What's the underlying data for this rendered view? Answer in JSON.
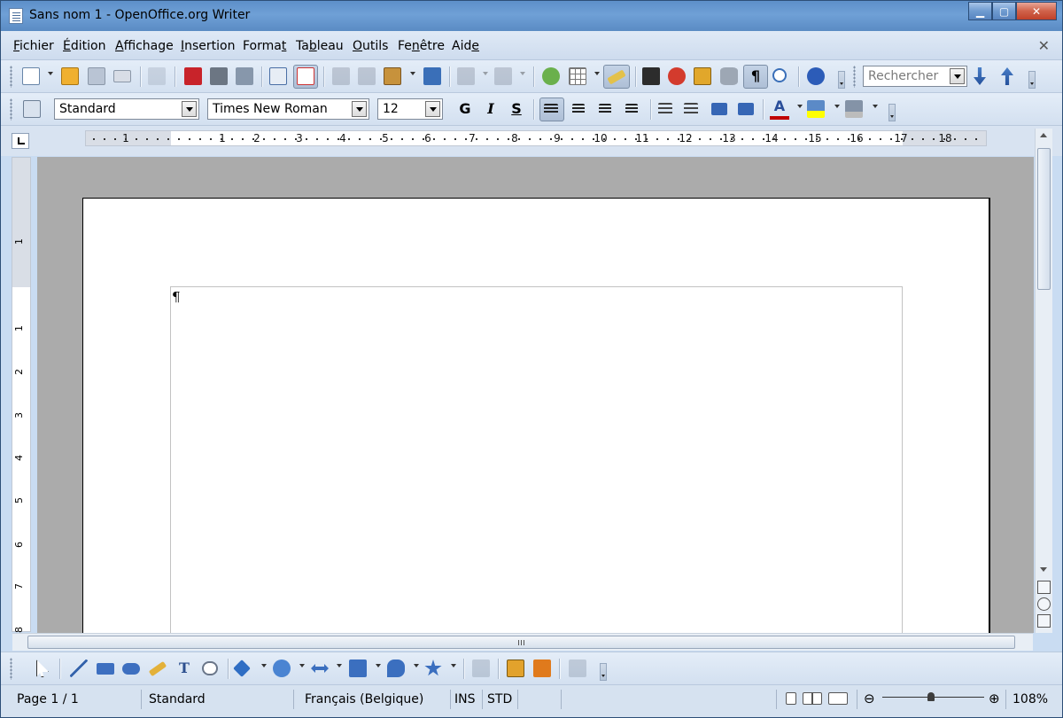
{
  "window": {
    "title": "Sans nom 1 - OpenOffice.org Writer",
    "controls": {
      "minimize": "▁",
      "maximize": "▢",
      "close": "✕"
    }
  },
  "menubar": {
    "items": [
      {
        "label": "Fichier",
        "u": "F",
        "rest": "ichier"
      },
      {
        "label": "Édition",
        "u": "É",
        "rest": "dition"
      },
      {
        "label": "Affichage",
        "u": "A",
        "rest": "ffichage"
      },
      {
        "label": "Insertion",
        "u": "I",
        "rest": "nsertion"
      },
      {
        "label": "Format",
        "pre": "Forma",
        "u": "t",
        "rest": ""
      },
      {
        "label": "Tableau",
        "pre": "Ta",
        "u": "b",
        "rest": "leau"
      },
      {
        "label": "Outils",
        "u": "O",
        "rest": "utils"
      },
      {
        "label": "Fenêtre",
        "pre": "Fe",
        "u": "n",
        "rest": "être"
      },
      {
        "label": "Aide",
        "pre": "Aid",
        "u": "e",
        "rest": ""
      }
    ],
    "close_doc": "✕"
  },
  "standard_toolbar": {
    "search_placeholder": "Rechercher",
    "icons": [
      "new-icon",
      "open-icon",
      "save-icon",
      "email-icon",
      "edit-file-icon",
      "export-pdf-icon",
      "print-icon",
      "print-preview-icon",
      "spellcheck-icon",
      "autospellcheck-icon",
      "cut-icon",
      "copy-icon",
      "paste-icon",
      "clone-formatting-icon",
      "undo-icon",
      "redo-icon",
      "hyperlink-icon",
      "table-icon",
      "show-draw-functions-icon",
      "find-replace-icon",
      "navigator-icon",
      "gallery-icon",
      "data-sources-icon",
      "nonprinting-chars-icon",
      "zoom-icon",
      "help-icon",
      "find-down-icon",
      "find-up-icon"
    ]
  },
  "formatting_toolbar": {
    "style": "Standard",
    "font": "Times New Roman",
    "size": "12",
    "bold": "G",
    "italic": "I",
    "underline": "S"
  },
  "ruler": {
    "numbers": [
      "1",
      "1",
      "2",
      "3",
      "4",
      "5",
      "6",
      "7",
      "8",
      "9",
      "10",
      "11",
      "12",
      "13",
      "14",
      "15",
      "16",
      "17",
      "18"
    ]
  },
  "vertical_ruler": {
    "numbers": [
      "1",
      "1",
      "2",
      "3",
      "4",
      "5",
      "6",
      "7",
      "8"
    ]
  },
  "document": {
    "paragraph_mark": "¶"
  },
  "scrollbars": {
    "h_thumb": "III"
  },
  "statusbar": {
    "page": "Page 1 / 1",
    "style": "Standard",
    "language": "Français (Belgique)",
    "ins": "INS",
    "std": "STD",
    "zoom": "108%",
    "zoom_minus": "⊖",
    "zoom_plus": "⊕"
  },
  "colors": {
    "titlebar": "#6fa0d6",
    "toolbar": "#dce7f4",
    "workspace": "#ababab",
    "font_color_underline": "#c00000",
    "highlight_color": "#ffff00"
  }
}
